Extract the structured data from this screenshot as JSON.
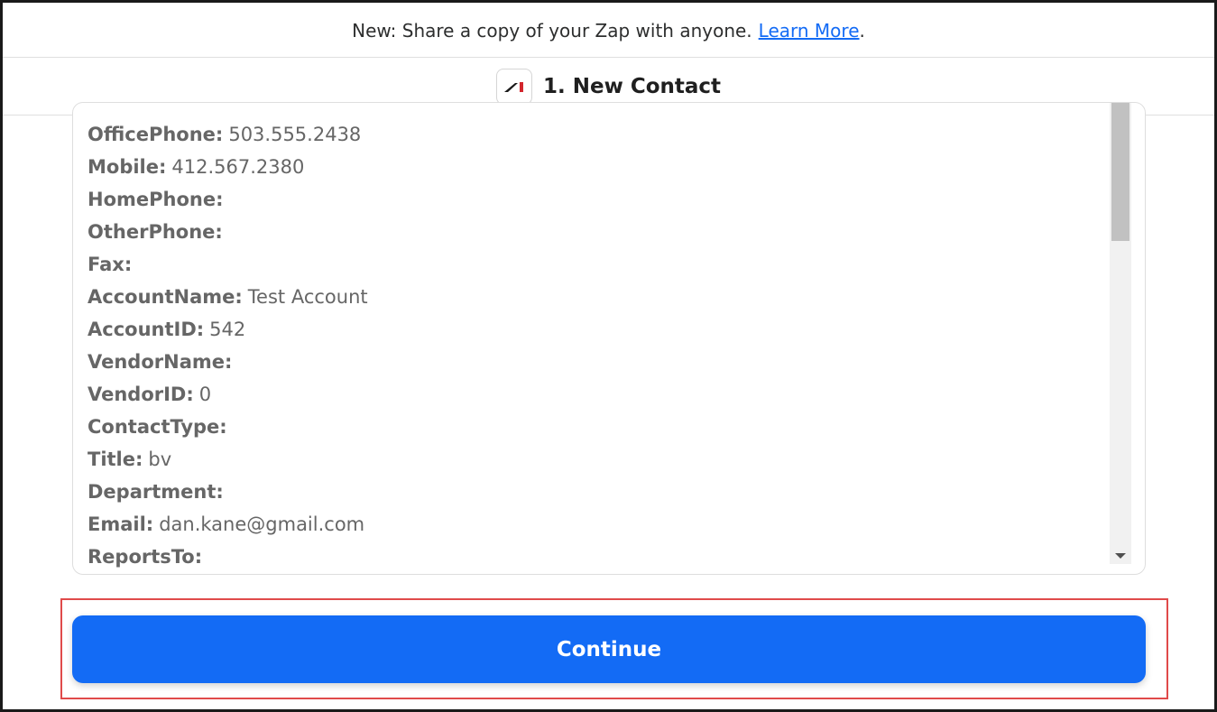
{
  "banner": {
    "text": "New: Share a copy of your Zap with anyone.",
    "link": "Learn More",
    "period": "."
  },
  "header": {
    "logo_icon": "app-logo-icon",
    "title": "1. New Contact"
  },
  "fields": [
    {
      "key": "OfficePhone:",
      "value": "503.555.2438"
    },
    {
      "key": "Mobile:",
      "value": "412.567.2380"
    },
    {
      "key": "HomePhone:",
      "value": ""
    },
    {
      "key": "OtherPhone:",
      "value": ""
    },
    {
      "key": "Fax:",
      "value": ""
    },
    {
      "key": "AccountName:",
      "value": "Test Account"
    },
    {
      "key": "AccountID:",
      "value": "542"
    },
    {
      "key": "VendorName:",
      "value": ""
    },
    {
      "key": "VendorID:",
      "value": "0"
    },
    {
      "key": "ContactType:",
      "value": ""
    },
    {
      "key": "Title:",
      "value": "bv"
    },
    {
      "key": "Department:",
      "value": ""
    },
    {
      "key": "Email:",
      "value": "dan.kane@gmail.com"
    },
    {
      "key": "ReportsTo:",
      "value": ""
    }
  ],
  "continue_label": "Continue",
  "colors": {
    "accent": "#136bf5",
    "highlight": "#e04a4a"
  }
}
